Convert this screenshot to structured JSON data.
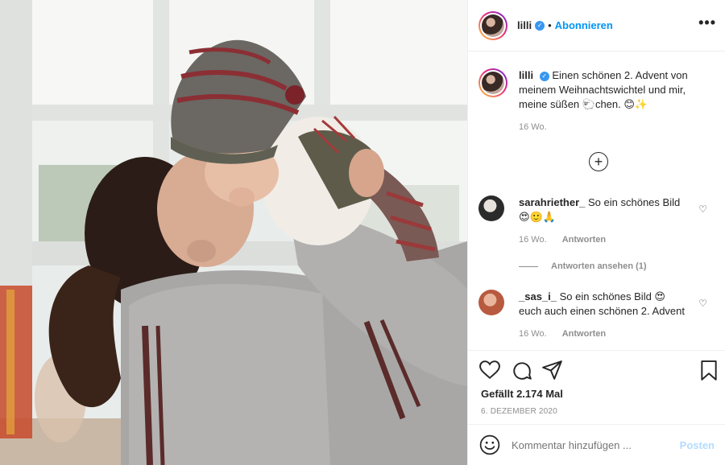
{
  "post": {
    "username": "lilli",
    "follow_label": "Abonnieren",
    "more_label": "•••",
    "verified_glyph": "✓",
    "dot": "•"
  },
  "caption": {
    "username": "lilli",
    "text": "Einen schönen 2. Advent von meinem Weihnachtswichtel und mir, meine süßen 🐑chen. 😊✨",
    "time": "16 Wo."
  },
  "load_more_label": "+",
  "comments": [
    {
      "username": "sarahriether_",
      "text": "So ein schönes Bild 😍🙂🙏",
      "time": "16 Wo.",
      "reply_label": "Antworten",
      "avatar_color": "#2b2b2b"
    },
    {
      "username": "_sas_i_",
      "text": "So ein schönes Bild 😍 euch auch einen schönen 2. Advent",
      "time": "16 Wo.",
      "reply_label": "Antworten",
      "avatar_color": "#c7745a"
    }
  ],
  "view_replies_label": "Antworten ansehen (1)",
  "likes": "Gefällt 2.174 Mal",
  "date": "6. DEZEMBER 2020",
  "comment_input": {
    "placeholder": "Kommentar hinzufügen ..."
  },
  "post_button": "Posten",
  "icons": {
    "like": "heart-outline",
    "comment": "speech-bubble",
    "share": "paper-plane",
    "save": "bookmark",
    "emoji": "smiley-face"
  },
  "colors": {
    "accent": "#0095f6",
    "muted": "#8e8e8e",
    "border": "#efefef",
    "post_disabled": "#b3dbff"
  }
}
